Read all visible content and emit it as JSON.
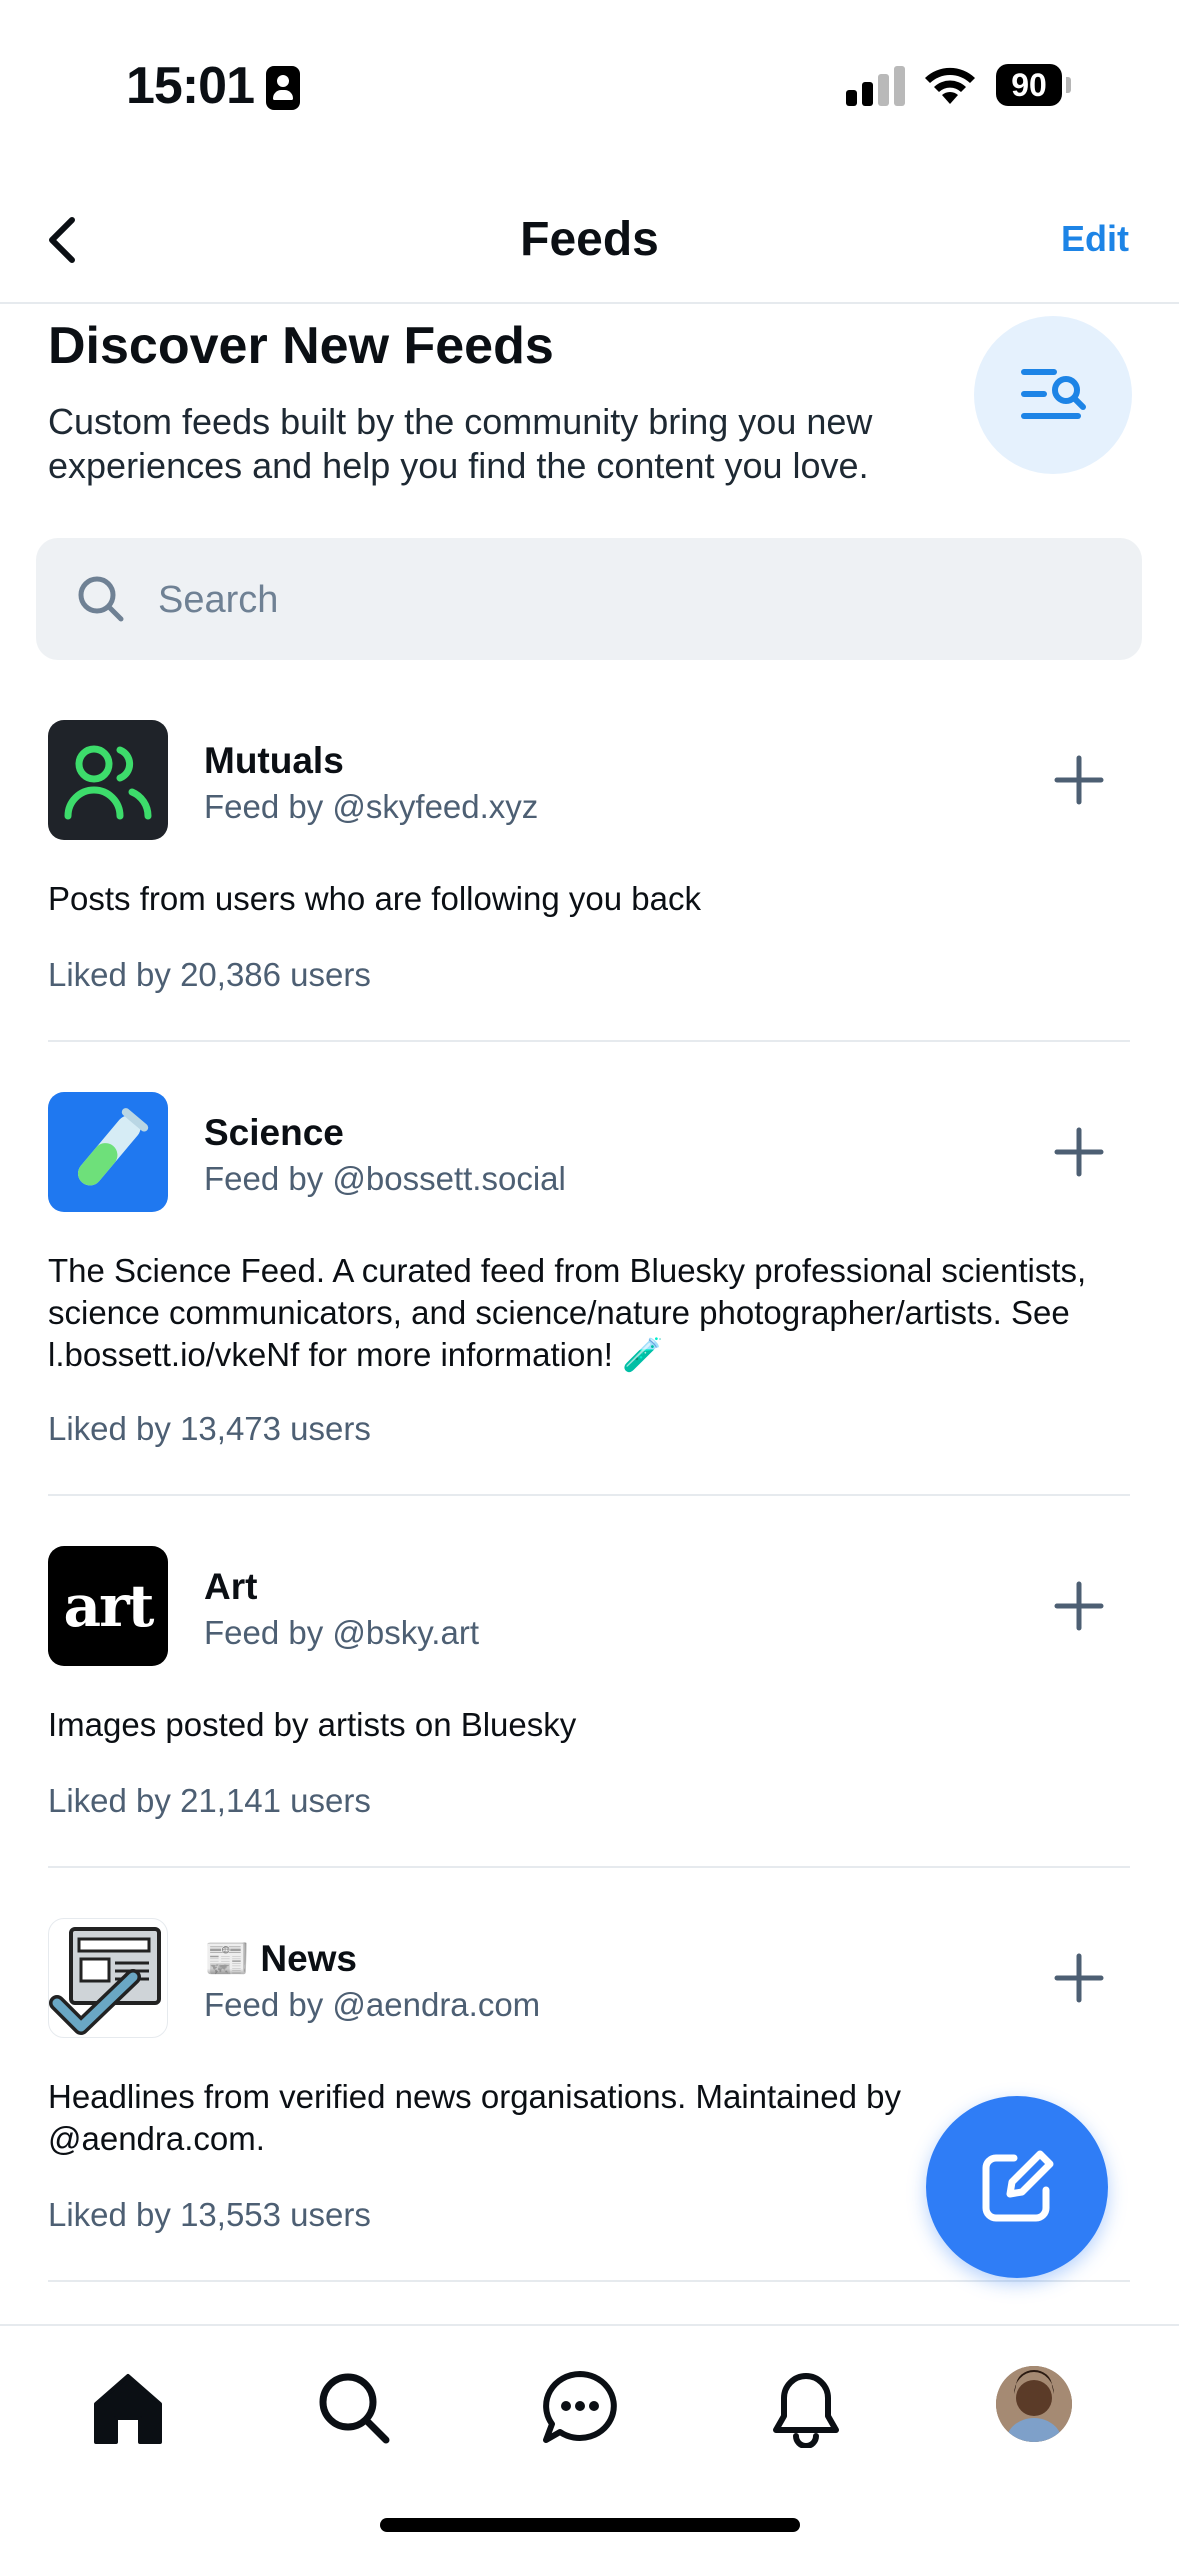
{
  "status_bar": {
    "time": "15:01",
    "battery": "90",
    "icons": [
      "id-badge-icon",
      "signal-icon",
      "wifi-icon",
      "battery-icon"
    ]
  },
  "header": {
    "title": "Feeds",
    "edit_label": "Edit",
    "back_icon": "chevron-left-icon"
  },
  "discover": {
    "title": "Discover New Feeds",
    "description": "Custom feeds built by the community bring you new experiences and help you find the content you love.",
    "icon": "list-search-icon"
  },
  "search": {
    "placeholder": "Search",
    "value": ""
  },
  "feeds": [
    {
      "name": "Mutuals",
      "by": "Feed by @skyfeed.xyz",
      "description": "Posts from users who are following you back",
      "likes": "Liked by 20,386 users",
      "avatar_icon": "people-icon"
    },
    {
      "name": "Science",
      "by": "Feed by @bossett.social",
      "description": "The Science Feed. A curated feed from Bluesky professional scientists,  science communicators, and science/nature photographer/artists. See l.bossett.io/vkeNf for more information! 🧪",
      "likes": "Liked by 13,473 users",
      "avatar_icon": "test-tube-icon"
    },
    {
      "name": "Art",
      "by": "Feed by @bsky.art",
      "description": "Images posted by artists on Bluesky",
      "likes": "Liked by 21,141 users",
      "avatar_text": "art"
    },
    {
      "name": "📰 News",
      "by": "Feed by @aendra.com",
      "description": "Headlines from verified news organisations. Maintained by @aendra.com.",
      "likes": "Liked by 13,553 users",
      "avatar_icon": "newspaper-check-icon"
    }
  ],
  "fab_icon": "compose-icon",
  "bottom_nav": [
    "home-icon",
    "search-icon",
    "chat-icon",
    "bell-icon",
    "profile-avatar"
  ],
  "colors": {
    "accent": "#1d84e6",
    "fab": "#2f7df6",
    "mutuals_bg": "#1f2329",
    "mutuals_icon": "#3ddc6b",
    "science_bg": "#1f78f0",
    "muted_text": "#4d5f73"
  }
}
